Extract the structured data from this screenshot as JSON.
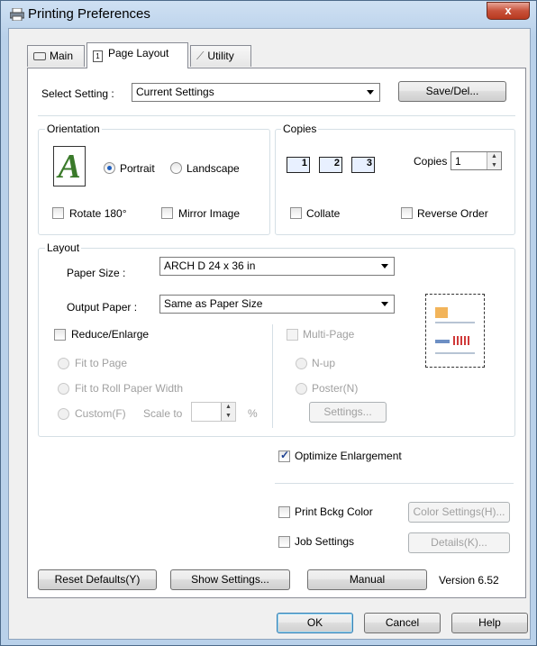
{
  "window": {
    "title": "Printing Preferences",
    "close_glyph": "x"
  },
  "tabs": [
    {
      "label": "Main",
      "icon": "printer-icon"
    },
    {
      "label": "Page Layout",
      "icon": "page-icon"
    },
    {
      "label": "Utility",
      "icon": "wrench-icon"
    }
  ],
  "select_setting": {
    "label": "Select Setting :",
    "value": "Current Settings",
    "save_del": "Save/Del..."
  },
  "orientation": {
    "title": "Orientation",
    "icon_letter": "A",
    "portrait": "Portrait",
    "landscape": "Landscape",
    "selected": "Portrait",
    "rotate180": "Rotate 180°",
    "mirror_image": "Mirror Image"
  },
  "copies": {
    "title": "Copies",
    "copies_label": "Copies",
    "copies_value": "1",
    "collate": "Collate",
    "reverse_order": "Reverse Order",
    "page_nums": [
      "1",
      "2",
      "3"
    ]
  },
  "layout": {
    "title": "Layout",
    "paper_size_label": "Paper Size :",
    "paper_size_value": "ARCH D 24 x 36 in",
    "output_paper_label": "Output Paper :",
    "output_paper_value": "Same as Paper Size",
    "reduce_enlarge": "Reduce/Enlarge",
    "fit_to_page": "Fit to Page",
    "fit_to_roll": "Fit to Roll Paper Width",
    "custom": "Custom(F)",
    "scale_to": "Scale to",
    "percent": "%",
    "multi_page": "Multi-Page",
    "n_up": "N-up",
    "poster": "Poster(N)",
    "settings": "Settings..."
  },
  "extras": {
    "optimize_enlargement": "Optimize Enlargement",
    "print_bckg_color": "Print Bckg Color",
    "color_settings": "Color Settings(H)...",
    "job_settings": "Job Settings",
    "details": "Details(K)..."
  },
  "bottom": {
    "reset_defaults": "Reset Defaults(Y)",
    "show_settings": "Show Settings...",
    "manual": "Manual",
    "version": "Version 6.52"
  },
  "dialog": {
    "ok": "OK",
    "cancel": "Cancel",
    "help": "Help"
  },
  "colors": {
    "accent_check": "#1b3f91",
    "title_bar": "#b9d1ea",
    "close": "#c8523b"
  }
}
